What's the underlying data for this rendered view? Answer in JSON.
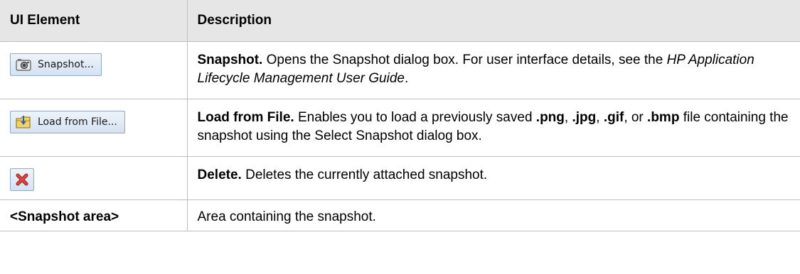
{
  "header": {
    "col1": "UI Element",
    "col2": "Description"
  },
  "rows": [
    {
      "button_label": "Snapshot...",
      "icon": "camera-icon",
      "title": "Snapshot.",
      "text1": " Opens the Snapshot dialog box. For user interface details, see the ",
      "italic": "HP Application Lifecycle Management User Guide",
      "text2": "."
    },
    {
      "button_label": "Load from File...",
      "icon": "folder-load-icon",
      "title": "Load from File.",
      "text1": " Enables you to load a previously saved ",
      "ext_png": ".png",
      "sep1": ", ",
      "ext_jpg": ".jpg",
      "sep2": ", ",
      "ext_gif": ".gif",
      "sep3": ", or ",
      "ext_bmp": ".bmp",
      "text2": " file containing the snapshot using the Select Snapshot dialog box."
    },
    {
      "icon": "delete-icon",
      "title": "Delete.",
      "text1": " Deletes the currently attached snapshot."
    },
    {
      "element": "<Snapshot area>",
      "text1": "Area containing the snapshot."
    }
  ],
  "colors": {
    "header_bg": "#e6e6e6",
    "border": "#bdbdbd",
    "button_bg": "#d4e2f2",
    "delete_red": "#d9352b"
  }
}
